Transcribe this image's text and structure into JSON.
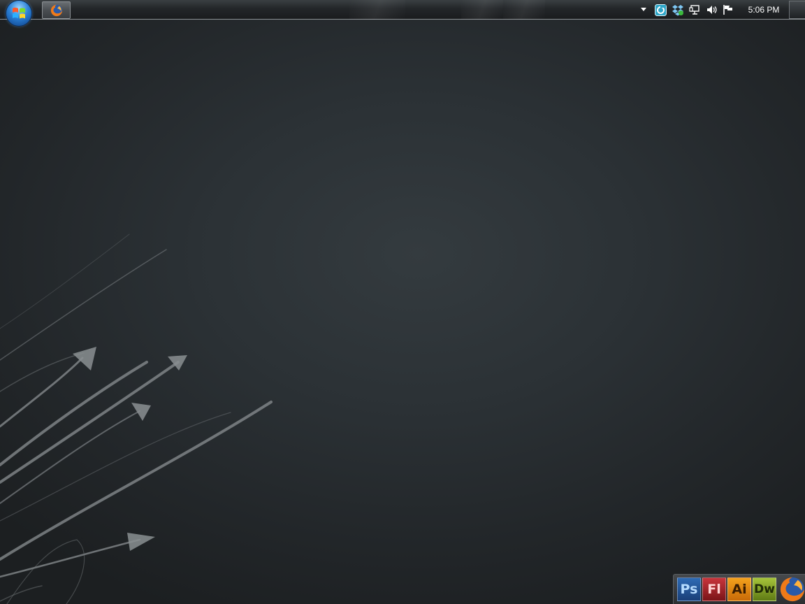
{
  "taskbar": {
    "start_button": "start-orb",
    "tasks": [
      {
        "app": "firefox",
        "icon": "firefox-icon",
        "active": false
      }
    ],
    "tray_icons": [
      "show-hidden-icons-arrow-icon",
      "sync-app-icon",
      "dropbox-icon",
      "network-icon",
      "volume-icon",
      "action-center-flag-icon"
    ],
    "clock": "5:06 PM"
  },
  "dock": {
    "apps": [
      {
        "label": "Ps",
        "color": "#2e6bb4"
      },
      {
        "label": "Fl",
        "color": "#c8353c"
      },
      {
        "label": "Ai",
        "color": "#f4a21c"
      },
      {
        "label": "Dw",
        "color": "#a6c43a"
      }
    ],
    "last_app_icon": "firefox-icon"
  },
  "colors": {
    "desktop_center": "#343b3f",
    "desktop_edge": "#1c1f21",
    "wallpaper_strokes": "#8a8f92"
  }
}
